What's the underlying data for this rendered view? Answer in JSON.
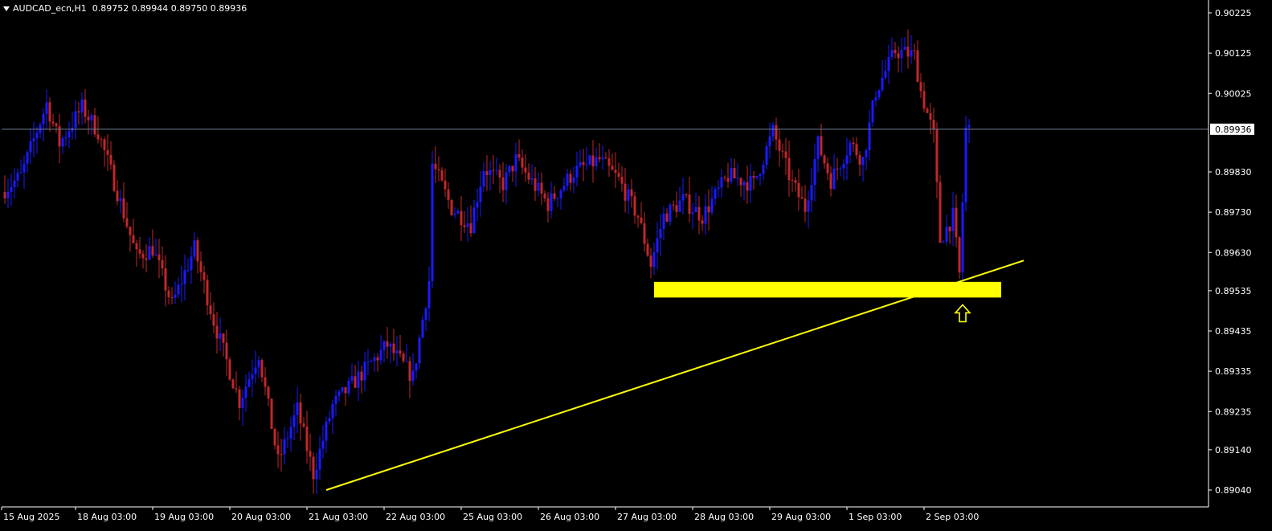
{
  "header": {
    "symbol": "AUDCAD_ecn,H1",
    "ohlc": "0.89752 0.89944 0.89750 0.89936"
  },
  "colors": {
    "background": "#000000",
    "bull": "#1a1aff",
    "bear": "#c0282a",
    "axis": "#ffffff",
    "price_line": "#6f7f95",
    "annotation": "#ffff00"
  },
  "chart_data": {
    "type": "candlestick",
    "symbol": "AUDCAD_ecn",
    "timeframe": "H1",
    "current_price": 0.89936,
    "current_price_label": "0.89936",
    "ylim": [
      0.8899,
      0.9024
    ],
    "y_ticks": [
      {
        "value": 0.90225,
        "label": "0.90225"
      },
      {
        "value": 0.90125,
        "label": "0.90125"
      },
      {
        "value": 0.90025,
        "label": "0.90025"
      },
      {
        "value": 0.8983,
        "label": "0.89830"
      },
      {
        "value": 0.8973,
        "label": "0.89730"
      },
      {
        "value": 0.8963,
        "label": "0.89630"
      },
      {
        "value": 0.89535,
        "label": "0.89535"
      },
      {
        "value": 0.89435,
        "label": "0.89435"
      },
      {
        "value": 0.89335,
        "label": "0.89335"
      },
      {
        "value": 0.89235,
        "label": "0.89235"
      },
      {
        "value": 0.8914,
        "label": "0.89140"
      },
      {
        "value": 0.8904,
        "label": "0.89040"
      }
    ],
    "x_ticks": [
      {
        "bar": 0,
        "label": "15 Aug 2025"
      },
      {
        "bar": 23,
        "label": "18 Aug 03:00"
      },
      {
        "bar": 47,
        "label": "19 Aug 03:00"
      },
      {
        "bar": 71,
        "label": "20 Aug 03:00"
      },
      {
        "bar": 95,
        "label": "21 Aug 03:00"
      },
      {
        "bar": 119,
        "label": "22 Aug 03:00"
      },
      {
        "bar": 143,
        "label": "25 Aug 03:00"
      },
      {
        "bar": 167,
        "label": "26 Aug 03:00"
      },
      {
        "bar": 191,
        "label": "27 Aug 03:00"
      },
      {
        "bar": 215,
        "label": "28 Aug 03:00"
      },
      {
        "bar": 239,
        "label": "29 Aug 03:00"
      },
      {
        "bar": 263,
        "label": "1 Sep 03:00"
      },
      {
        "bar": 287,
        "label": "2 Sep 03:00"
      }
    ],
    "bar_count": 300,
    "price_path": [
      [
        0,
        0.8978
      ],
      [
        6,
        0.8982
      ],
      [
        14,
        0.9
      ],
      [
        18,
        0.899
      ],
      [
        25,
        0.8999
      ],
      [
        30,
        0.8993
      ],
      [
        36,
        0.8978
      ],
      [
        42,
        0.8962
      ],
      [
        47,
        0.8964
      ],
      [
        53,
        0.895
      ],
      [
        60,
        0.8964
      ],
      [
        66,
        0.8946
      ],
      [
        74,
        0.8926
      ],
      [
        80,
        0.8938
      ],
      [
        86,
        0.8911
      ],
      [
        92,
        0.8924
      ],
      [
        97,
        0.8908
      ],
      [
        103,
        0.8925
      ],
      [
        111,
        0.8932
      ],
      [
        120,
        0.894
      ],
      [
        128,
        0.8932
      ],
      [
        133,
        0.8956
      ],
      [
        134,
        0.8985
      ],
      [
        140,
        0.8974
      ],
      [
        146,
        0.897
      ],
      [
        150,
        0.8984
      ],
      [
        156,
        0.898
      ],
      [
        160,
        0.8986
      ],
      [
        170,
        0.8975
      ],
      [
        178,
        0.8983
      ],
      [
        186,
        0.8986
      ],
      [
        192,
        0.8981
      ],
      [
        198,
        0.8972
      ],
      [
        202,
        0.896
      ],
      [
        206,
        0.8972
      ],
      [
        212,
        0.8976
      ],
      [
        218,
        0.8972
      ],
      [
        226,
        0.8982
      ],
      [
        234,
        0.898
      ],
      [
        240,
        0.8993
      ],
      [
        246,
        0.898
      ],
      [
        250,
        0.8974
      ],
      [
        254,
        0.899
      ],
      [
        258,
        0.8981
      ],
      [
        264,
        0.899
      ],
      [
        268,
        0.8986
      ],
      [
        272,
        0.9003
      ],
      [
        278,
        0.9013
      ],
      [
        284,
        0.9012
      ],
      [
        286,
        0.9003
      ],
      [
        290,
        0.8992
      ],
      [
        292,
        0.8966
      ],
      [
        296,
        0.8972
      ],
      [
        298,
        0.89575
      ],
      [
        300,
        0.89936
      ]
    ],
    "annotations": {
      "support_zone": {
        "bar_start": 202,
        "bar_end": 310,
        "price_top": 0.89545,
        "price_bottom": 0.8953
      },
      "trendline": {
        "bar_start": 100,
        "price_start": 0.8904,
        "bar_end": 317,
        "price_end": 0.8961
      },
      "arrow": {
        "bar": 298,
        "price": 0.895,
        "direction": "up"
      }
    }
  }
}
